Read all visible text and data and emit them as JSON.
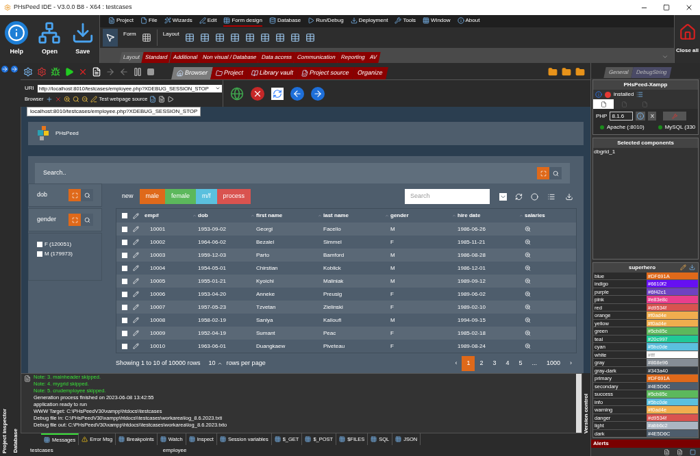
{
  "window": {
    "title": "PHsPeed IDE - V3.0.0 B8 - X64 : testcases"
  },
  "ribbon": {
    "big_buttons": [
      {
        "label": "Help",
        "kind": "help"
      },
      {
        "label": "Open",
        "kind": "open"
      },
      {
        "label": "Save",
        "kind": "save"
      }
    ],
    "menu": [
      {
        "label": "Project",
        "selected": false
      },
      {
        "label": "File",
        "selected": false
      },
      {
        "label": "Wizards",
        "selected": false
      },
      {
        "label": "Edit",
        "selected": false
      },
      {
        "label": "Form design",
        "selected": true
      },
      {
        "label": "Database",
        "selected": false
      },
      {
        "label": "Run/Debug",
        "selected": false
      },
      {
        "label": "Deployment",
        "selected": false
      },
      {
        "label": "Tools",
        "selected": false
      },
      {
        "label": "Window",
        "selected": false
      },
      {
        "label": "About",
        "selected": false
      }
    ],
    "groups": [
      "Form",
      "Layout"
    ],
    "component_tabs": [
      {
        "label": "Layout",
        "selected": true
      },
      {
        "label": "Standard",
        "selected": false
      },
      {
        "label": "Additional",
        "selected": false
      },
      {
        "label": "Non visual / Database",
        "selected": false
      },
      {
        "label": "Data access",
        "selected": false
      },
      {
        "label": "Communication",
        "selected": false
      },
      {
        "label": "Reporting",
        "selected": false
      },
      {
        "label": "AV",
        "selected": false
      }
    ],
    "close_button": "Close all"
  },
  "ide_tabs": [
    {
      "label": "Browser",
      "selected": true
    },
    {
      "label": "Project",
      "selected": false
    },
    {
      "label": "Library vault",
      "selected": false
    },
    {
      "label": "Project source",
      "selected": false
    },
    {
      "label": "Organize",
      "selected": false
    }
  ],
  "browser": {
    "uri_label": "URI",
    "url": "http://localhost:8010/testcases/employee.php?XDEBUG_SESSION_STOP",
    "browser_label": "Browser",
    "source_label": "Test webpage source",
    "tooltip": "localhost:8010/testcases/employee.php?XDEBUG_SESSION_STOP"
  },
  "page": {
    "brand": "PHsPeed",
    "search_placeholder": "Search..",
    "filters": [
      {
        "label": "dob"
      },
      {
        "label": "gender"
      }
    ],
    "options": [
      {
        "label": "F (120051)",
        "checked": false
      },
      {
        "label": "M (179973)",
        "checked": false
      }
    ],
    "buttons": [
      {
        "label": "new"
      },
      {
        "label": "male",
        "color": "#df691a"
      },
      {
        "label": "female",
        "color": "#5cb85c"
      },
      {
        "label": "m/f",
        "color": "#5bc0de"
      },
      {
        "label": "process",
        "color": "#d9534f"
      }
    ],
    "grid_search_placeholder": "Search",
    "select_all_checked": false,
    "columns": [
      "emp#",
      "dob",
      "first name",
      "last name",
      "gender",
      "hire date",
      "salaries"
    ],
    "rows": [
      {
        "checked": false,
        "cells": [
          "10001",
          "1953-09-02",
          "Georgi",
          "Facello",
          "M",
          "1986-06-26"
        ]
      },
      {
        "checked": false,
        "cells": [
          "10002",
          "1964-06-02",
          "Bezalel",
          "Simmel",
          "F",
          "1985-11-21"
        ]
      },
      {
        "checked": false,
        "cells": [
          "10003",
          "1959-12-03",
          "Parto",
          "Bamford",
          "M",
          "1986-08-28"
        ]
      },
      {
        "checked": false,
        "cells": [
          "10004",
          "1954-05-01",
          "Chirstian",
          "Koblick",
          "M",
          "1986-12-01"
        ]
      },
      {
        "checked": false,
        "cells": [
          "10005",
          "1955-01-21",
          "Kyoichi",
          "Maliniak",
          "M",
          "1989-09-12"
        ]
      },
      {
        "checked": false,
        "cells": [
          "10006",
          "1953-04-20",
          "Anneke",
          "Preusig",
          "F",
          "1989-06-02"
        ]
      },
      {
        "checked": false,
        "cells": [
          "10007",
          "1957-05-23",
          "Tzvetan",
          "Zielinski",
          "F",
          "1989-02-10"
        ]
      },
      {
        "checked": false,
        "cells": [
          "10008",
          "1958-02-19",
          "Saniya",
          "Kalloufi",
          "M",
          "1994-09-15"
        ]
      },
      {
        "checked": false,
        "cells": [
          "10009",
          "1952-04-19",
          "Sumant",
          "Peac",
          "F",
          "1985-02-18"
        ]
      },
      {
        "checked": false,
        "cells": [
          "10010",
          "1963-06-01",
          "Duangkaew",
          "Piveteau",
          "F",
          "1989-08-24"
        ]
      }
    ],
    "summary": "Showing 1 to 10 of 10000 rows",
    "page_size": "10",
    "page_size_label": "rows per page",
    "pages": [
      {
        "label": "‹",
        "selected": false
      },
      {
        "label": "1",
        "selected": true
      },
      {
        "label": "2",
        "selected": false
      },
      {
        "label": "3",
        "selected": false
      },
      {
        "label": "4",
        "selected": false
      },
      {
        "label": "5",
        "selected": false
      },
      {
        "label": "...",
        "selected": false
      },
      {
        "label": "1000",
        "selected": false
      },
      {
        "label": "›",
        "selected": false
      }
    ]
  },
  "log": [
    {
      "kind": "note",
      "text": "Note: 3. mainheader skipped."
    },
    {
      "kind": "note",
      "text": "Note: 4. mygrid skipped."
    },
    {
      "kind": "note",
      "text": "Note: 5. crudemployee skipped."
    },
    {
      "kind": "info",
      "text": "Generation process finished on 2023-06-08 13:42:55"
    },
    {
      "kind": "info",
      "text": "application ready to run"
    },
    {
      "kind": "info",
      "text": "WWW Target: C:\\PHsPeedV30\\xampp\\htdocs\\\\testcases"
    },
    {
      "kind": "info",
      "text": "Debug file in: C:\\PHsPeedV30\\xampp\\htdocs\\\\testcases\\workarea\\log_8.6.2023.txti"
    },
    {
      "kind": "info",
      "text": "Debug file out: C:\\PHsPeedV30\\xampp\\htdocs\\\\testcases\\workarea\\log_8.6.2023.txto"
    }
  ],
  "bottom_tabs": [
    {
      "label": "Messages",
      "selected": true
    },
    {
      "label": "Error Msg",
      "selected": false
    },
    {
      "label": "Breakpoints",
      "selected": false
    },
    {
      "label": "Watch",
      "selected": false
    },
    {
      "label": "Inspect",
      "selected": false
    },
    {
      "label": "Session variables",
      "selected": false
    },
    {
      "label": "$_GET",
      "selected": false
    },
    {
      "label": "$_POST",
      "selected": false
    },
    {
      "label": "$FILES",
      "selected": false
    },
    {
      "label": "SQL",
      "selected": false
    },
    {
      "label": "JSON",
      "selected": false
    }
  ],
  "side_labels": [
    "Project inspector",
    "Database"
  ],
  "version_label": "Version control",
  "status_bar": [
    "testcases",
    "employee"
  ],
  "right_panel": {
    "tabs": [
      {
        "label": "General",
        "selected": true
      },
      {
        "label": "DebugString",
        "selected": false
      }
    ],
    "server": {
      "title": "PHsPeed-Xampp",
      "status": "installed",
      "mini_tabs": [
        {
          "selected": true
        },
        {
          "selected": false
        },
        {
          "selected": false
        }
      ],
      "php_label": "PHP",
      "php_version": "8.1.6",
      "close": "X",
      "services": [
        {
          "label": "Apache (:8010)",
          "on": true
        },
        {
          "label": "MySQL (330",
          "on": true
        }
      ]
    },
    "selected_title": "Selected components",
    "selected_items": [
      "dbgrid_1"
    ],
    "theme": {
      "title": "superhero",
      "colors": [
        {
          "name": "blue",
          "value": "#DF691A",
          "color": "#df691a"
        },
        {
          "name": "indigo",
          "value": "#6610f2",
          "color": "#6610f2"
        },
        {
          "name": "purple",
          "value": "#6f42c1",
          "color": "#6f42c1"
        },
        {
          "name": "pink",
          "value": "#e83e8c",
          "color": "#e83e8c"
        },
        {
          "name": "red",
          "value": "#d9534f",
          "color": "#d9534f"
        },
        {
          "name": "orange",
          "value": "#f0ad4e",
          "color": "#f0ad4e"
        },
        {
          "name": "yellow",
          "value": "#f0ad4e",
          "color": "#f0ad4e"
        },
        {
          "name": "green",
          "value": "#5cb85c",
          "color": "#5cb85c"
        },
        {
          "name": "teal",
          "value": "#20c997",
          "color": "#20c997"
        },
        {
          "name": "cyan",
          "value": "#5bc0de",
          "color": "#5bc0de"
        },
        {
          "name": "white",
          "value": "#fff",
          "color": "#ffffff"
        },
        {
          "name": "gray",
          "value": "#868e96",
          "color": "#868e96"
        },
        {
          "name": "gray-dark",
          "value": "#343a40",
          "color": "#343a40"
        },
        {
          "name": "primary",
          "value": "#DF691A",
          "color": "#df691a"
        },
        {
          "name": "secondary",
          "value": "#4E5D6C",
          "color": "#4e5d6c"
        },
        {
          "name": "success",
          "value": "#5cb85c",
          "color": "#5cb85c"
        },
        {
          "name": "info",
          "value": "#5bc0de",
          "color": "#5bc0de"
        },
        {
          "name": "warning",
          "value": "#f0ad4e",
          "color": "#f0ad4e"
        },
        {
          "name": "danger",
          "value": "#d9534f",
          "color": "#d9534f"
        },
        {
          "name": "light",
          "value": "#abb6c2",
          "color": "#abb6c2"
        },
        {
          "name": "dark",
          "value": "#4E5D6C",
          "color": "#4e5d6c"
        }
      ]
    },
    "alerts": "Alerts"
  }
}
